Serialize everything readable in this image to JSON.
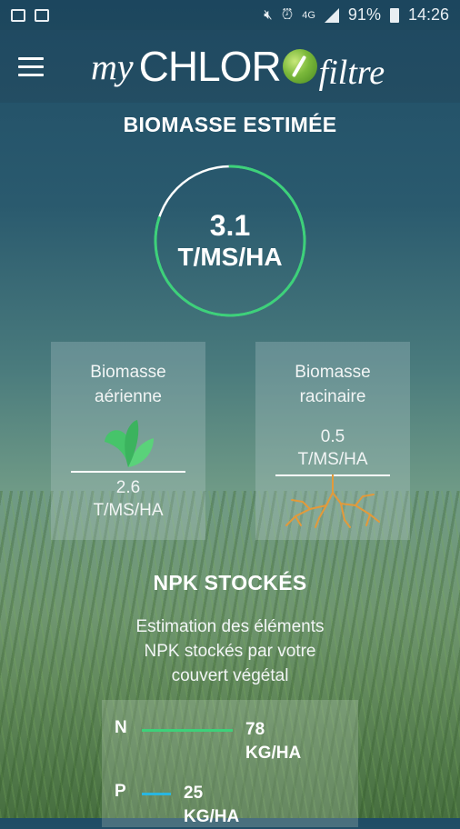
{
  "status_bar": {
    "battery": "91%",
    "network": "4G",
    "time": "14:26"
  },
  "app": {
    "logo_my": "my",
    "logo_brand": "CHLOR",
    "logo_suffix": "filtre"
  },
  "biomasse": {
    "title": "BIOMASSE ESTIMÉE",
    "total_value": "3.1",
    "total_unit": "T/MS/HA",
    "ring_progress": 0.8,
    "ring_color": "#3dd17a",
    "aerienne": {
      "title_line1": "Biomasse",
      "title_line2": "aérienne",
      "value": "2.6",
      "unit": "T/MS/HA",
      "icon": "leaf-icon"
    },
    "racinaire": {
      "title_line1": "Biomasse",
      "title_line2": "racinaire",
      "value": "0.5",
      "unit": "T/MS/HA",
      "icon": "roots-icon"
    }
  },
  "npk": {
    "title": "NPK STOCKÉS",
    "desc_line1": "Estimation des éléments",
    "desc_line2": "NPK stockés par votre",
    "desc_line3": "couvert végétal",
    "rows": [
      {
        "letter": "N",
        "value": "78",
        "unit": "KG/HA",
        "color": "#3dd17a"
      },
      {
        "letter": "P",
        "value": "25",
        "unit": "KG/HA",
        "color": "#29b6e0"
      }
    ]
  }
}
